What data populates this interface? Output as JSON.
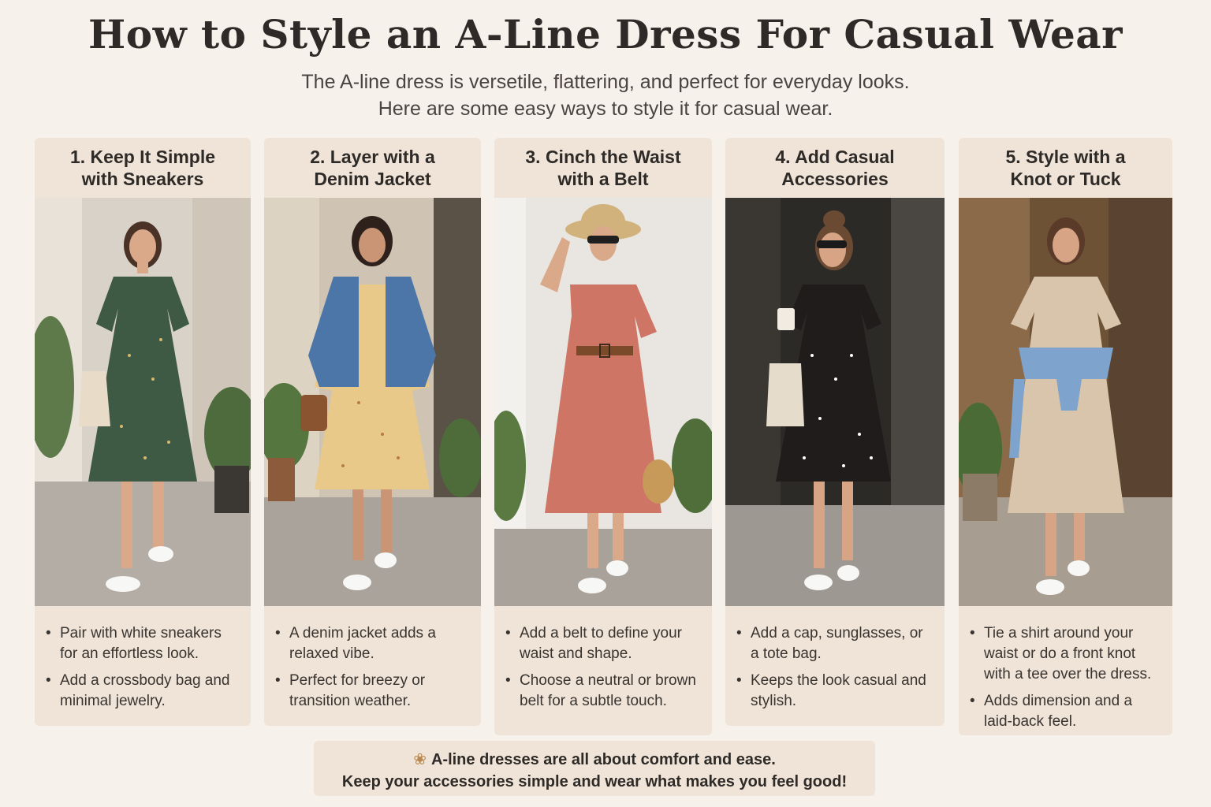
{
  "header": {
    "title": "How to Style an A-Line Dress For Casual Wear",
    "subtitle_line1": "The A-line dress is versetile, flattering, and perfect for everyday looks.",
    "subtitle_line2": "Here are some easy ways to style it for casual wear."
  },
  "cards": [
    {
      "title_line1": "1. Keep It Simple",
      "title_line2": "with Sneakers",
      "dress_color": "#3e5a45",
      "bullets": [
        "Pair with white sneakers for an effortless look.",
        "Add a crossbody bag and minimal jewelry."
      ]
    },
    {
      "title_line1": "2. Layer with a",
      "title_line2": "Denim Jacket",
      "dress_color": "#e8c98a",
      "bullets": [
        "A denim jacket adds a relaxed vibe.",
        "Perfect for breezy or transition weather."
      ]
    },
    {
      "title_line1": "3. Cinch the Waist",
      "title_line2": "with a Belt",
      "dress_color": "#cf7566",
      "bullets": [
        "Add a belt to define your waist and shape.",
        "Choose a neutral or brown belt for a subtle touch."
      ]
    },
    {
      "title_line1": "4. Add Casual",
      "title_line2": "Accessories",
      "dress_color": "#1f1c1b",
      "bullets": [
        "Add a cap, sunglasses, or a tote bag.",
        "Keeps the look casual and stylish."
      ]
    },
    {
      "title_line1": "5. Style with a",
      "title_line2": "Knot or Tuck",
      "dress_color": "#d9c5ab",
      "bullets": [
        "Tie a shirt around your waist or do a front knot with a tee over the dress.",
        "Adds dimension and a laid-back feel."
      ]
    }
  ],
  "footer": {
    "icon": "flower-icon",
    "line1": "A-line dresses are all about comfort and ease.",
    "line2": "Keep your accessories simple and wear what makes you feel good!"
  }
}
